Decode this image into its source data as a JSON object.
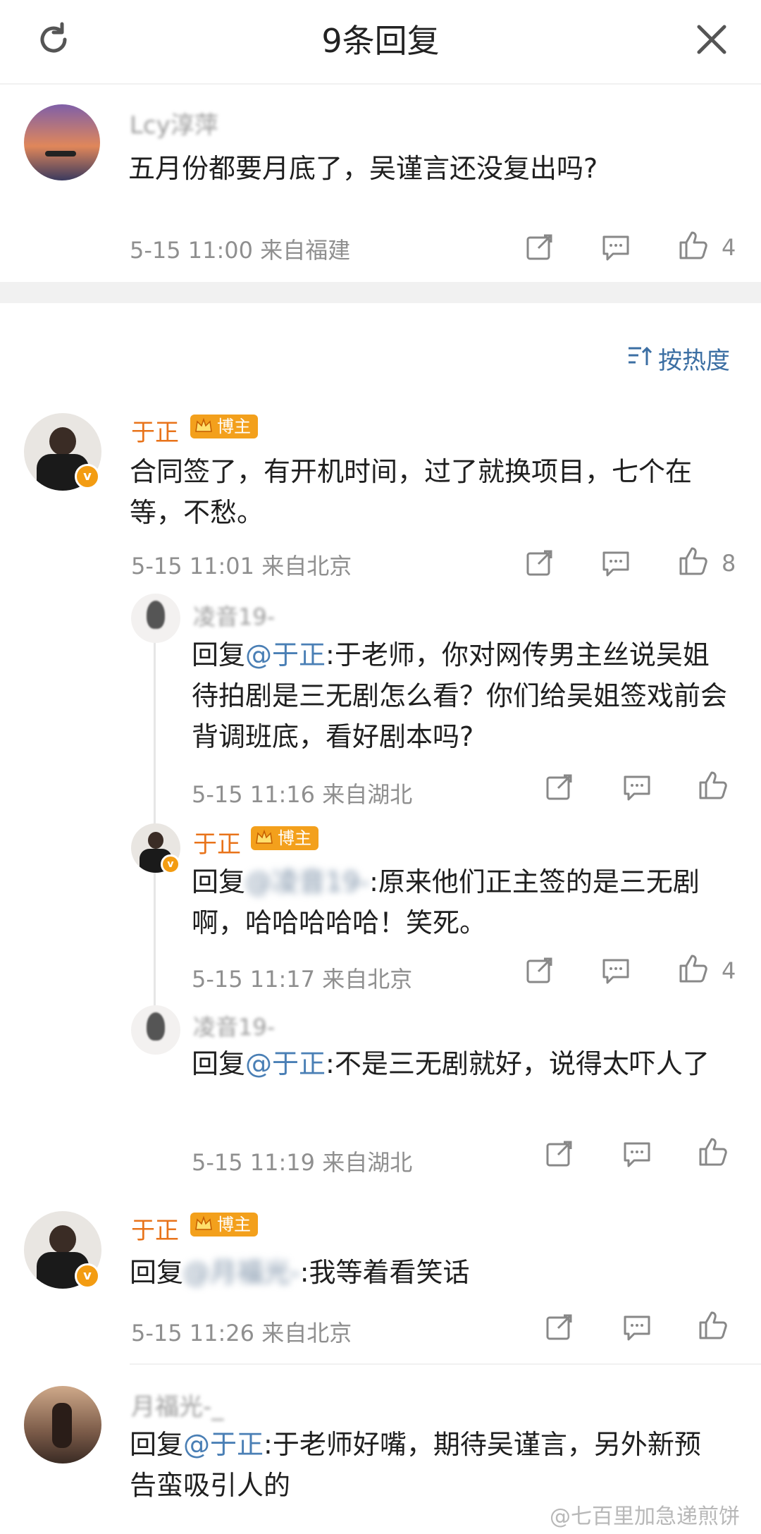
{
  "header": {
    "title": "9条回复"
  },
  "sort_label": "按热度",
  "root_comment": {
    "author": "Lcy淳萍",
    "text": "五月份都要月底了，吴谨言还没复出吗?",
    "meta": "5-15 11:00 来自福建",
    "likes": "4"
  },
  "replies": [
    {
      "author": "于正",
      "badge": "博主",
      "text": "合同签了，有开机时间，过了就换项目，七个在等，不愁。",
      "meta": "5-15 11:01 来自北京",
      "likes": "8"
    },
    {
      "author": "凌音19-",
      "prefix": "回复",
      "mention": "@于正",
      "text": ":于老师，你对网传男主丝说吴姐待拍剧是三无剧怎么看？你们给吴姐签戏前会背调班底，看好剧本吗?",
      "meta": "5-15 11:16 来自湖北"
    },
    {
      "author": "于正",
      "badge": "博主",
      "prefix": "回复",
      "mention": "@凌音19-",
      "text": ":原来他们正主签的是三无剧啊，哈哈哈哈哈！笑死。",
      "meta": "5-15 11:17 来自北京",
      "likes": "4"
    },
    {
      "author": "凌音19-",
      "prefix": "回复",
      "mention": "@于正",
      "text": ":不是三无剧就好，说得太吓人了",
      "meta": "5-15 11:19 来自湖北"
    },
    {
      "author": "于正",
      "badge": "博主",
      "prefix": "回复",
      "mention": "@月福光-",
      "text": ":我等着看笑话",
      "meta": "5-15 11:26 来自北京"
    },
    {
      "author": "月福光-_",
      "prefix": "回复",
      "mention": "@于正",
      "text": ":于老师好嘴，期待吴谨言，另外新预告蛮吸引人的"
    }
  ],
  "watermark": "@七百里加急递煎饼",
  "colors": {
    "accent_orange": "#e8731a",
    "mention_blue": "#4a7fb5",
    "badge": "#f3a01c"
  },
  "icons": [
    "refresh-icon",
    "close-icon",
    "share-icon",
    "comment-icon",
    "like-icon",
    "crown-icon",
    "verified-icon",
    "sort-icon"
  ]
}
